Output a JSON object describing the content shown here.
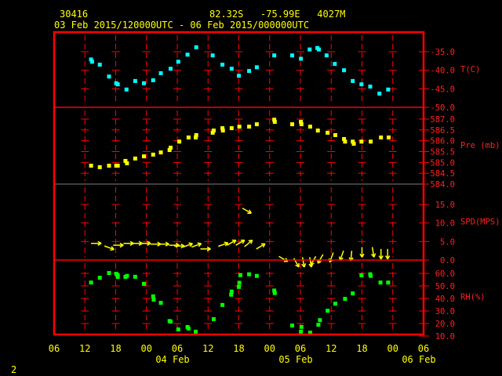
{
  "header": {
    "station_id": "30416",
    "location": "82.32S   -75.99E   4027M",
    "time_range": "03 Feb 2015/120000UTC - 06 Feb 2015/000000UTC",
    "page_number": "2"
  },
  "colors": {
    "frame": "#ff0000",
    "text": "#ffff00",
    "temp": "#00ffff",
    "pressure": "#ffff00",
    "wind": "#ffff00",
    "rh": "#00ff00"
  },
  "chart_data": [
    {
      "type": "scatter",
      "name": "temperature",
      "ylabel": "T(C)",
      "ylim": [
        -50,
        -32
      ],
      "yticks": [
        "-35.0",
        "-40.0",
        "-45.0",
        "-50.0"
      ],
      "ytick_values": [
        -35,
        -40,
        -45,
        -50
      ],
      "x_units": "hours since 03 Feb 12UTC",
      "points": [
        [
          1.2,
          -37.1
        ],
        [
          1.4,
          -37.7
        ],
        [
          2.9,
          -38.5
        ],
        [
          4.7,
          -41.7
        ],
        [
          6.1,
          -43.5
        ],
        [
          6.4,
          -43.8
        ],
        [
          8.1,
          -45.2
        ],
        [
          9.8,
          -42.9
        ],
        [
          11.5,
          -43.5
        ],
        [
          13.3,
          -42.7
        ],
        [
          14.8,
          -40.8
        ],
        [
          16.7,
          -39.6
        ],
        [
          18.2,
          -37.7
        ],
        [
          20.0,
          -35.8
        ],
        [
          21.7,
          -33.8
        ],
        [
          24.9,
          -36.0
        ],
        [
          26.8,
          -38.5
        ],
        [
          28.6,
          -39.6
        ],
        [
          30.0,
          -41.5
        ],
        [
          32.0,
          -40.2
        ],
        [
          33.5,
          -39.2
        ],
        [
          36.9,
          -36.0
        ],
        [
          40.4,
          -36.0
        ],
        [
          42.1,
          -36.9
        ],
        [
          43.8,
          -34.4
        ],
        [
          45.3,
          -34.0
        ],
        [
          45.6,
          -34.4
        ],
        [
          47.1,
          -36.0
        ],
        [
          48.7,
          -38.3
        ],
        [
          50.5,
          -40.0
        ],
        [
          52.2,
          -42.9
        ],
        [
          53.9,
          -43.8
        ],
        [
          55.6,
          -44.4
        ],
        [
          57.4,
          -46.3
        ],
        [
          59.1,
          -45.2
        ]
      ]
    },
    {
      "type": "scatter",
      "name": "pressure",
      "ylabel": "Pre (mb)",
      "ylim": [
        584.0,
        587.55
      ],
      "yticks": [
        "587.0",
        "586.5",
        "586.0",
        "585.5",
        "585.0",
        "584.5",
        "584.0"
      ],
      "ytick_values": [
        587.0,
        586.5,
        586.0,
        585.5,
        585.0,
        584.5,
        584.0
      ],
      "points": [
        [
          1.2,
          584.85
        ],
        [
          2.9,
          584.78
        ],
        [
          4.7,
          584.85
        ],
        [
          6.1,
          584.85
        ],
        [
          6.4,
          584.85
        ],
        [
          7.9,
          585.07
        ],
        [
          8.2,
          584.96
        ],
        [
          9.8,
          585.18
        ],
        [
          11.5,
          585.28
        ],
        [
          13.3,
          585.36
        ],
        [
          14.8,
          585.46
        ],
        [
          16.5,
          585.57
        ],
        [
          16.7,
          585.68
        ],
        [
          18.4,
          585.96
        ],
        [
          20.2,
          586.15
        ],
        [
          21.6,
          586.15
        ],
        [
          21.7,
          586.26
        ],
        [
          24.9,
          586.37
        ],
        [
          25.1,
          586.47
        ],
        [
          26.8,
          586.58
        ],
        [
          26.9,
          586.47
        ],
        [
          28.6,
          586.58
        ],
        [
          30.1,
          586.65
        ],
        [
          32.0,
          586.65
        ],
        [
          33.5,
          586.76
        ],
        [
          36.9,
          586.97
        ],
        [
          37.0,
          586.87
        ],
        [
          40.4,
          586.76
        ],
        [
          42.1,
          586.87
        ],
        [
          42.2,
          586.76
        ],
        [
          43.9,
          586.65
        ],
        [
          45.4,
          586.47
        ],
        [
          47.3,
          586.37
        ],
        [
          48.8,
          586.26
        ],
        [
          50.5,
          586.08
        ],
        [
          50.7,
          585.96
        ],
        [
          52.2,
          585.96
        ],
        [
          52.4,
          585.86
        ],
        [
          53.9,
          585.96
        ],
        [
          55.7,
          585.96
        ],
        [
          57.7,
          586.15
        ],
        [
          59.2,
          586.15
        ]
      ]
    },
    {
      "type": "vector",
      "name": "wind",
      "ylabel": "SPD(MPS)",
      "ylim": [
        0,
        20.5
      ],
      "yticks": [
        "15.0",
        "10.0",
        "5.0",
        "0.0"
      ],
      "ytick_values": [
        15,
        10,
        5,
        0
      ],
      "vector_fields": [
        "hour",
        "speed",
        "screen_direction_deg"
      ],
      "points": [
        [
          1.2,
          4.5,
          0
        ],
        [
          3.8,
          3.8,
          20
        ],
        [
          5.5,
          4,
          0
        ],
        [
          7.5,
          4.5,
          0
        ],
        [
          9.2,
          4.5,
          0
        ],
        [
          10.8,
          4.5,
          0
        ],
        [
          12.8,
          4.3,
          0
        ],
        [
          14.4,
          4.3,
          0
        ],
        [
          16.4,
          4,
          0
        ],
        [
          17.4,
          3.8,
          0
        ],
        [
          19.1,
          3.5,
          -20
        ],
        [
          20.8,
          3.5,
          -20
        ],
        [
          22.5,
          3,
          0
        ],
        [
          26,
          3.7,
          -20
        ],
        [
          27.7,
          4,
          -30
        ],
        [
          29.4,
          4,
          -30
        ],
        [
          30.7,
          14,
          30
        ],
        [
          31.1,
          3.6,
          -40
        ],
        [
          33.4,
          3,
          -30
        ],
        [
          37.8,
          1,
          30
        ],
        [
          40.7,
          0.5,
          60
        ],
        [
          42.4,
          0.8,
          80
        ],
        [
          43.8,
          0.8,
          80
        ],
        [
          45,
          1,
          120
        ],
        [
          46.4,
          1.5,
          120
        ],
        [
          48.4,
          2,
          110
        ],
        [
          50.4,
          2.5,
          110
        ],
        [
          52,
          2.5,
          95
        ],
        [
          54,
          3.5,
          90
        ],
        [
          56,
          3.5,
          80
        ],
        [
          57.7,
          3,
          90
        ],
        [
          59,
          3,
          90
        ]
      ]
    },
    {
      "type": "scatter",
      "name": "relative-humidity",
      "ylabel": "RH(%)",
      "ylim": [
        10,
        70
      ],
      "yticks": [
        "60.0",
        "50.0",
        "40.0",
        "30.0",
        "20.0",
        "10.0"
      ],
      "ytick_values": [
        60,
        50,
        40,
        30,
        20,
        10
      ],
      "points": [
        [
          1.2,
          52.7
        ],
        [
          2.9,
          56.5
        ],
        [
          4.7,
          60.3
        ],
        [
          6.1,
          59.7
        ],
        [
          6.4,
          58.5
        ],
        [
          6.4,
          57.2
        ],
        [
          7.9,
          57.2
        ],
        [
          8.2,
          58
        ],
        [
          9.8,
          57.3
        ],
        [
          11.5,
          51.7
        ],
        [
          13.3,
          41.7
        ],
        [
          13.4,
          39
        ],
        [
          14.8,
          36.5
        ],
        [
          16.5,
          22
        ],
        [
          16.7,
          21.5
        ],
        [
          18.2,
          15.3
        ],
        [
          20.0,
          17.2
        ],
        [
          20.2,
          16
        ],
        [
          21.6,
          13.5
        ],
        [
          25.1,
          23.5
        ],
        [
          26.8,
          34.8
        ],
        [
          28.5,
          43
        ],
        [
          28.6,
          45.5
        ],
        [
          30.0,
          49.2
        ],
        [
          30.1,
          52.5
        ],
        [
          30.3,
          58.6
        ],
        [
          32.0,
          59.3
        ],
        [
          33.5,
          58
        ],
        [
          36.9,
          46.3
        ],
        [
          37.0,
          44.3
        ],
        [
          40.4,
          18.4
        ],
        [
          42.1,
          13.5
        ],
        [
          42.2,
          17.3
        ],
        [
          43.9,
          12.7
        ],
        [
          45.5,
          19
        ],
        [
          45.8,
          22.7
        ],
        [
          47.3,
          30.2
        ],
        [
          48.8,
          35.8
        ],
        [
          50.7,
          39.7
        ],
        [
          52.2,
          44
        ],
        [
          53.9,
          58.5
        ],
        [
          55.6,
          59.3
        ],
        [
          55.7,
          58
        ],
        [
          57.6,
          52.7
        ],
        [
          59.1,
          52.7
        ]
      ]
    }
  ],
  "x_axis": {
    "xlim_hours": [
      -6,
      66
    ],
    "tick_hours": [
      -6,
      0,
      6,
      12,
      18,
      24,
      30,
      36,
      42,
      48,
      54,
      60,
      66
    ],
    "tick_labels": [
      "06",
      "12",
      "18",
      "00",
      "06",
      "12",
      "18",
      "00",
      "06",
      "12",
      "18",
      "00",
      "06"
    ],
    "date_labels": [
      {
        "hour": 18,
        "label": "04 Feb"
      },
      {
        "hour": 42,
        "label": "05 Feb"
      },
      {
        "hour": 66,
        "label": "06 Feb"
      }
    ]
  }
}
